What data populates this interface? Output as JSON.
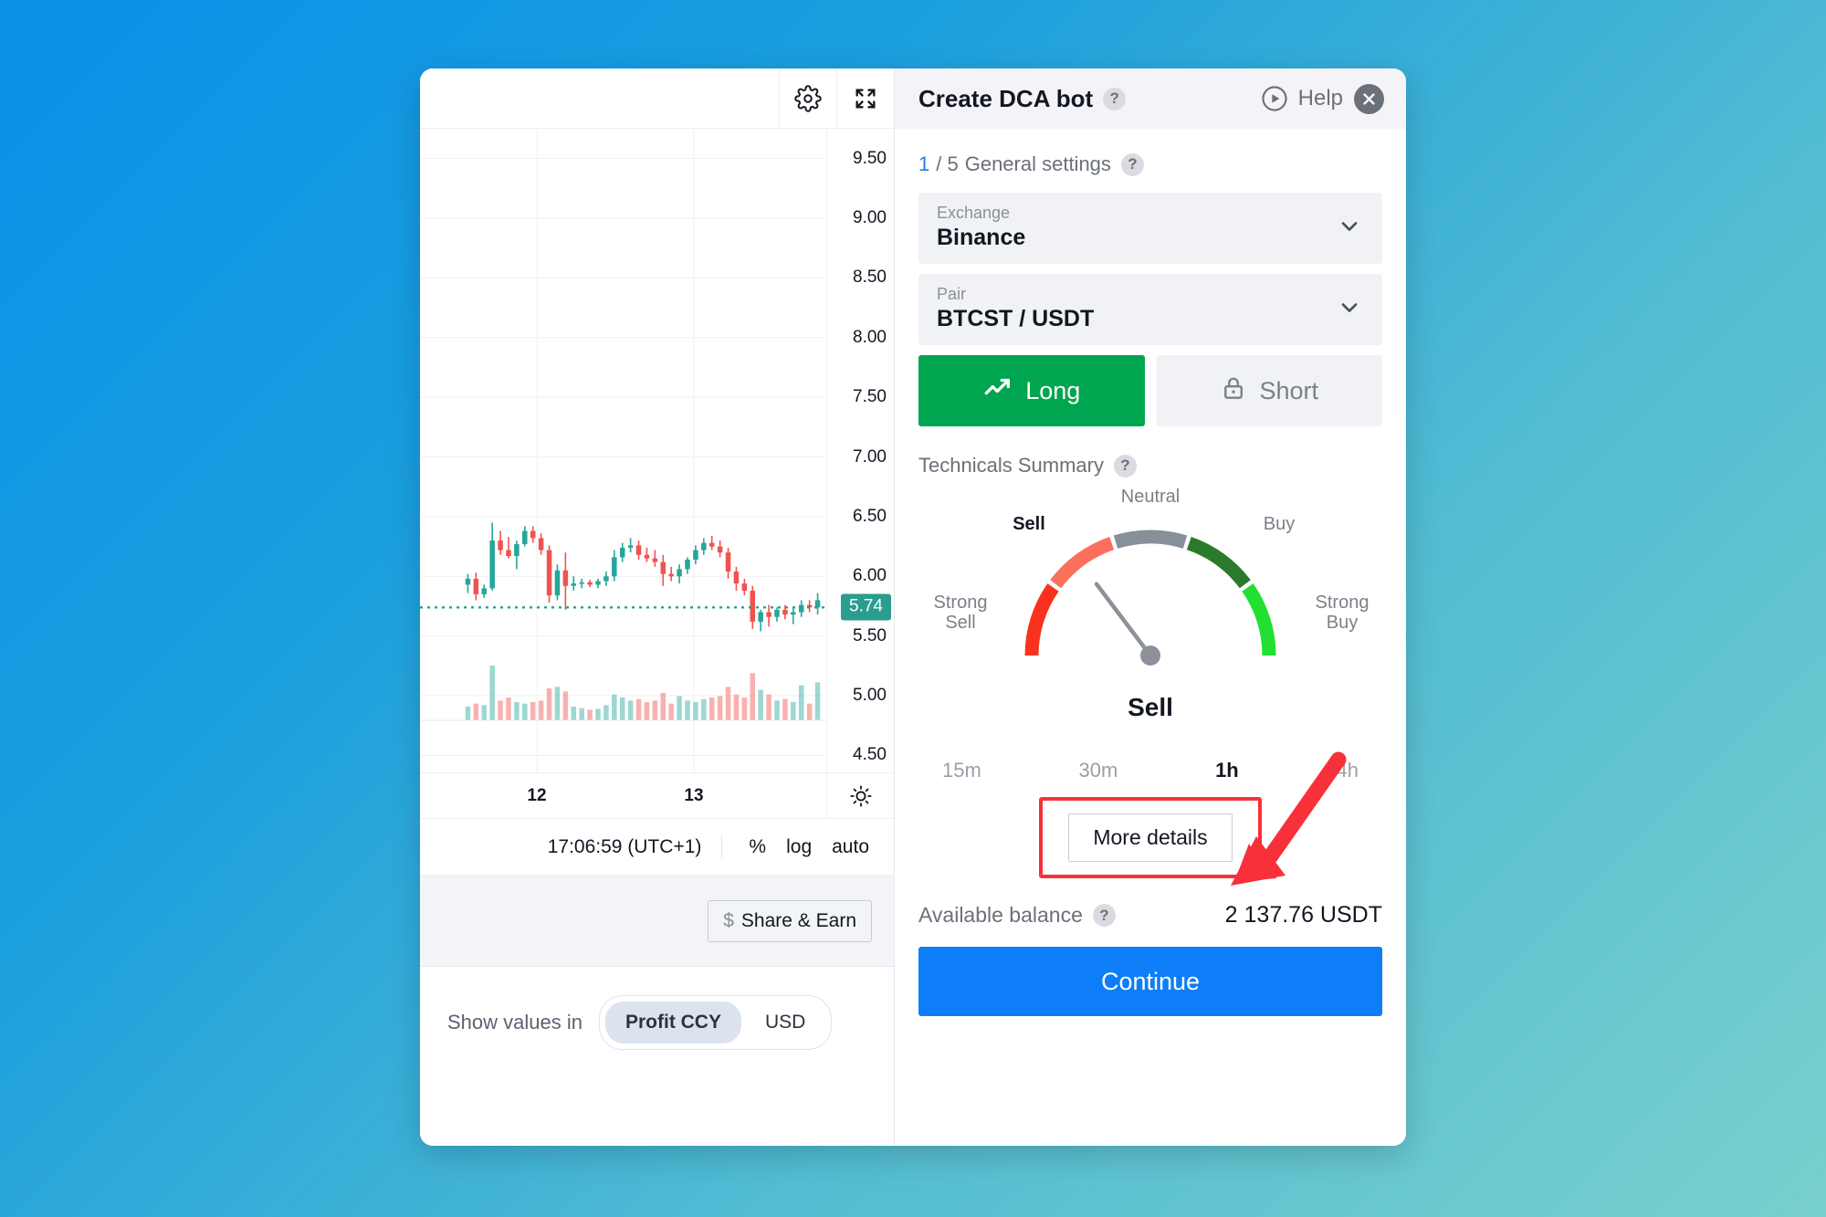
{
  "background": {
    "from": "#0a91e8",
    "to": "#79d0cd"
  },
  "chart": {
    "toolbar": {
      "settings_icon": "gear-icon",
      "fullscreen_icon": "fullscreen-icon"
    },
    "price_ticks": [
      "9.50",
      "9.00",
      "8.50",
      "8.00",
      "7.50",
      "7.00",
      "6.50",
      "6.00",
      "5.50",
      "5.00",
      "4.50"
    ],
    "current_price": "5.74",
    "current_price_color": "#2a9d8f",
    "time_labels": [
      "12",
      "13"
    ],
    "sun_icon": "brightness-icon",
    "clock": "17:06:59 (UTC+1)",
    "status_buttons": [
      "%",
      "log",
      "auto"
    ],
    "share_button": {
      "dollar": "$",
      "label": "Share & Earn"
    },
    "values_label": "Show values in",
    "values_options": [
      {
        "label": "Profit CCY",
        "active": true
      },
      {
        "label": "USD",
        "active": false
      }
    ],
    "candle_up_color": "#26a69a",
    "candle_down_color": "#ef5350"
  },
  "chart_data": {
    "type": "candlestick",
    "title": "BTCST / USDT",
    "ylabel": "",
    "xlabel": "",
    "ylim": [
      4.35,
      9.75
    ],
    "yticks": [
      9.5,
      9.0,
      8.5,
      8.0,
      7.5,
      7.0,
      6.5,
      6.0,
      5.5,
      5.0,
      4.5
    ],
    "xticks": [
      "12",
      "13"
    ],
    "last_price": 5.74,
    "grid": true,
    "candles": [
      {
        "o": 5.93,
        "h": 6.02,
        "l": 5.86,
        "c": 5.98,
        "v": 0.18
      },
      {
        "o": 5.98,
        "h": 6.03,
        "l": 5.8,
        "c": 5.85,
        "v": 0.22
      },
      {
        "o": 5.85,
        "h": 5.93,
        "l": 5.82,
        "c": 5.9,
        "v": 0.2
      },
      {
        "o": 5.9,
        "h": 6.45,
        "l": 5.88,
        "c": 6.3,
        "v": 0.72
      },
      {
        "o": 6.3,
        "h": 6.38,
        "l": 6.18,
        "c": 6.22,
        "v": 0.26
      },
      {
        "o": 6.22,
        "h": 6.33,
        "l": 6.15,
        "c": 6.17,
        "v": 0.3
      },
      {
        "o": 6.17,
        "h": 6.3,
        "l": 6.06,
        "c": 6.27,
        "v": 0.24
      },
      {
        "o": 6.27,
        "h": 6.42,
        "l": 6.25,
        "c": 6.38,
        "v": 0.22
      },
      {
        "o": 6.38,
        "h": 6.42,
        "l": 6.28,
        "c": 6.32,
        "v": 0.24
      },
      {
        "o": 6.32,
        "h": 6.36,
        "l": 6.18,
        "c": 6.22,
        "v": 0.26
      },
      {
        "o": 6.22,
        "h": 6.26,
        "l": 5.78,
        "c": 5.84,
        "v": 0.42
      },
      {
        "o": 5.84,
        "h": 6.1,
        "l": 5.8,
        "c": 6.05,
        "v": 0.44
      },
      {
        "o": 6.05,
        "h": 6.2,
        "l": 5.72,
        "c": 5.92,
        "v": 0.38
      },
      {
        "o": 5.92,
        "h": 6.0,
        "l": 5.88,
        "c": 5.94,
        "v": 0.18
      },
      {
        "o": 5.94,
        "h": 5.98,
        "l": 5.9,
        "c": 5.95,
        "v": 0.16
      },
      {
        "o": 5.95,
        "h": 5.97,
        "l": 5.91,
        "c": 5.93,
        "v": 0.14
      },
      {
        "o": 5.93,
        "h": 5.98,
        "l": 5.9,
        "c": 5.96,
        "v": 0.15
      },
      {
        "o": 5.96,
        "h": 6.04,
        "l": 5.92,
        "c": 6.0,
        "v": 0.2
      },
      {
        "o": 6.0,
        "h": 6.22,
        "l": 5.96,
        "c": 6.16,
        "v": 0.34
      },
      {
        "o": 6.16,
        "h": 6.28,
        "l": 6.12,
        "c": 6.24,
        "v": 0.3
      },
      {
        "o": 6.24,
        "h": 6.32,
        "l": 6.2,
        "c": 6.26,
        "v": 0.26
      },
      {
        "o": 6.26,
        "h": 6.3,
        "l": 6.14,
        "c": 6.18,
        "v": 0.28
      },
      {
        "o": 6.18,
        "h": 6.24,
        "l": 6.12,
        "c": 6.15,
        "v": 0.24
      },
      {
        "o": 6.15,
        "h": 6.22,
        "l": 6.08,
        "c": 6.12,
        "v": 0.26
      },
      {
        "o": 6.12,
        "h": 6.18,
        "l": 5.92,
        "c": 6.02,
        "v": 0.36
      },
      {
        "o": 6.02,
        "h": 6.08,
        "l": 5.96,
        "c": 6.0,
        "v": 0.22
      },
      {
        "o": 6.0,
        "h": 6.1,
        "l": 5.94,
        "c": 6.06,
        "v": 0.32
      },
      {
        "o": 6.06,
        "h": 6.16,
        "l": 6.02,
        "c": 6.14,
        "v": 0.26
      },
      {
        "o": 6.14,
        "h": 6.26,
        "l": 6.1,
        "c": 6.22,
        "v": 0.24
      },
      {
        "o": 6.22,
        "h": 6.32,
        "l": 6.18,
        "c": 6.28,
        "v": 0.28
      },
      {
        "o": 6.28,
        "h": 6.34,
        "l": 6.22,
        "c": 6.25,
        "v": 0.3
      },
      {
        "o": 6.25,
        "h": 6.3,
        "l": 6.16,
        "c": 6.2,
        "v": 0.32
      },
      {
        "o": 6.2,
        "h": 6.24,
        "l": 5.98,
        "c": 6.04,
        "v": 0.44
      },
      {
        "o": 6.04,
        "h": 6.08,
        "l": 5.88,
        "c": 5.94,
        "v": 0.34
      },
      {
        "o": 5.94,
        "h": 5.98,
        "l": 5.84,
        "c": 5.88,
        "v": 0.3
      },
      {
        "o": 5.88,
        "h": 5.92,
        "l": 5.56,
        "c": 5.62,
        "v": 0.62
      },
      {
        "o": 5.62,
        "h": 5.72,
        "l": 5.54,
        "c": 5.7,
        "v": 0.4
      },
      {
        "o": 5.7,
        "h": 5.76,
        "l": 5.58,
        "c": 5.66,
        "v": 0.34
      },
      {
        "o": 5.66,
        "h": 5.74,
        "l": 5.62,
        "c": 5.72,
        "v": 0.26
      },
      {
        "o": 5.72,
        "h": 5.76,
        "l": 5.64,
        "c": 5.68,
        "v": 0.28
      },
      {
        "o": 5.68,
        "h": 5.74,
        "l": 5.6,
        "c": 5.7,
        "v": 0.24
      },
      {
        "o": 5.7,
        "h": 5.8,
        "l": 5.66,
        "c": 5.76,
        "v": 0.46
      },
      {
        "o": 5.76,
        "h": 5.8,
        "l": 5.7,
        "c": 5.74,
        "v": 0.22
      },
      {
        "o": 5.74,
        "h": 5.86,
        "l": 5.68,
        "c": 5.8,
        "v": 0.5
      }
    ]
  },
  "panel": {
    "title": "Create DCA bot",
    "play_icon": "play-circle-icon",
    "help_label": "Help",
    "close_icon": "close-icon",
    "step": {
      "current": "1",
      "separator": "/ 5",
      "label": "General settings"
    },
    "exchange": {
      "label": "Exchange",
      "value": "Binance"
    },
    "pair": {
      "label": "Pair",
      "value": "BTCST / USDT"
    },
    "sides": [
      {
        "label": "Long",
        "icon": "trending-up-icon",
        "active": true,
        "color": "#00a54f"
      },
      {
        "label": "Short",
        "icon": "lock-icon",
        "active": false
      }
    ],
    "technicals": {
      "heading": "Technicals Summary",
      "verdict": "Sell",
      "labels": {
        "strong_sell": "Strong\nSell",
        "sell": "Sell",
        "neutral": "Neutral",
        "buy": "Buy",
        "strong_buy": "Strong\nBuy"
      },
      "segment_colors": {
        "strong_sell": "#f8321e",
        "sell": "#fa705c",
        "neutral": "#878f99",
        "buy": "#2b7a2b",
        "strong_buy": "#22e032"
      },
      "timeframes": [
        {
          "label": "15m",
          "active": false
        },
        {
          "label": "30m",
          "active": false
        },
        {
          "label": "1h",
          "active": true
        },
        {
          "label": "4h",
          "active": false
        }
      ],
      "more_details": "More details"
    },
    "balance": {
      "label": "Available balance",
      "value": "2 137.76 USDT"
    },
    "continue": "Continue"
  },
  "annotation": {
    "color": "#f8303a",
    "arrow": "arrow-pointing-to-more-details"
  }
}
